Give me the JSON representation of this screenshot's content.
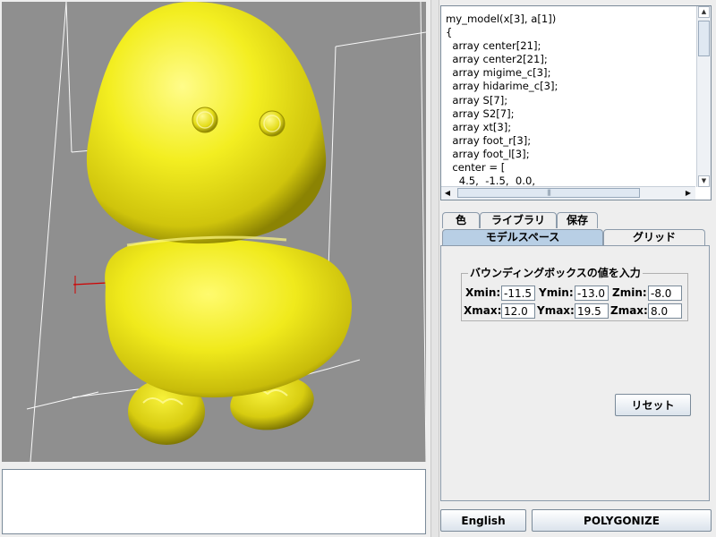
{
  "code_editor": {
    "lines": [
      "my_model(x[3], a[1])",
      "{",
      "  array center[21];",
      "  array center2[21];",
      "  array migime_c[3];",
      "  array hidarime_c[3];",
      "  array S[7];",
      "  array S2[7];",
      "  array xt[3];",
      "  array foot_r[3];",
      "  array foot_l[3];",
      "  center = [",
      "    4.5,  -1.5,  0.0,"
    ]
  },
  "tabs_row1": [
    "色",
    "ライブラリ",
    "保存"
  ],
  "tabs_row2": [
    "モデルスペース",
    "グリッド"
  ],
  "bounding_box": {
    "title": "バウンディングボックスの値を入力",
    "xmin_label": "Xmin:",
    "xmin": "-11.5",
    "ymin_label": "Ymin:",
    "ymin": "-13.0",
    "zmin_label": "Zmin:",
    "zmin": "-8.0",
    "xmax_label": "Xmax:",
    "xmax": "12.0",
    "ymax_label": "Ymax:",
    "ymax": "19.5",
    "zmax_label": "Zmax:",
    "zmax": "8.0"
  },
  "buttons": {
    "reset": "リセット",
    "english": "English",
    "polygonize": "POLYGONIZE"
  },
  "colors": {
    "viewport_bg": "#8f8f8f",
    "model": "#f2ee1c",
    "selected_tab": "#b8cfe5"
  }
}
